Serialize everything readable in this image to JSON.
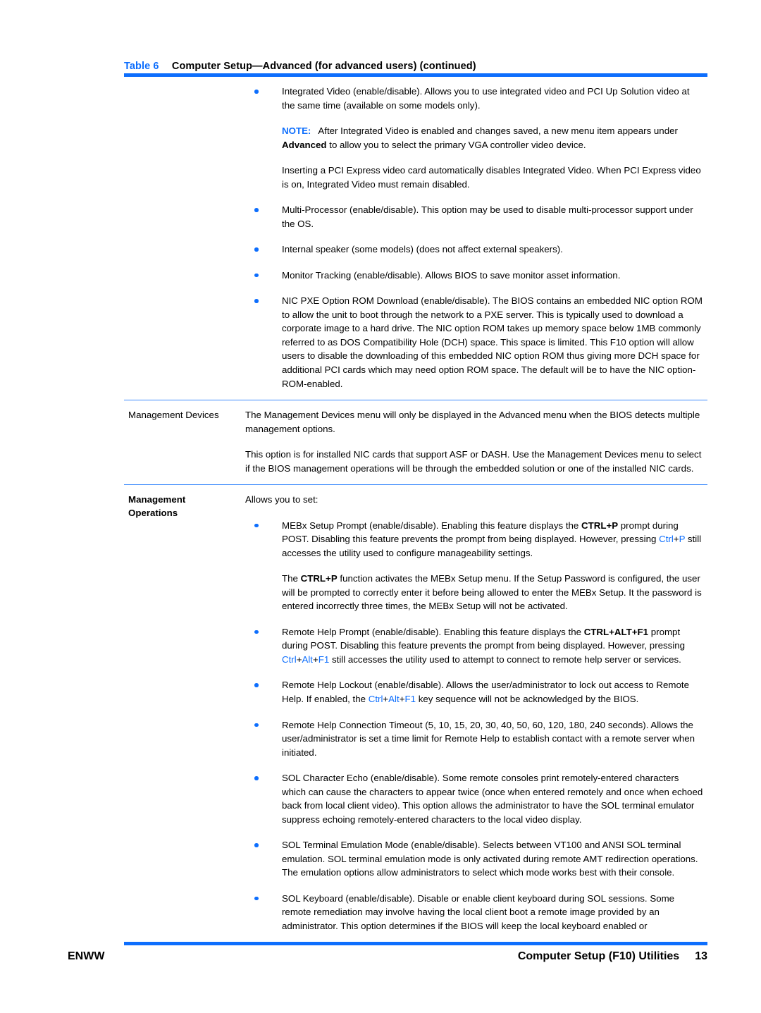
{
  "caption": {
    "label": "Table 6",
    "title": "Computer Setup—Advanced (for advanced users) (continued)"
  },
  "colors": {
    "accent_blue": "#0d6efd",
    "rule_blue": "#3d8bfd",
    "text": "#000000"
  },
  "rows": [
    {
      "label": "",
      "blocks": [
        {
          "kind": "bullet",
          "text": "Integrated Video (enable/disable). Allows you to use integrated video and PCI Up Solution video at the same time (available on some models only)."
        },
        {
          "kind": "note",
          "note_label": "NOTE:",
          "pre": "After Integrated Video is enabled and changes saved, a new menu item appears under ",
          "bold": "Advanced",
          "post": " to allow you to select the primary VGA controller video device."
        },
        {
          "kind": "indent",
          "text": "Inserting a PCI Express video card automatically disables Integrated Video. When PCI Express video is on, Integrated Video must remain disabled."
        },
        {
          "kind": "bullet",
          "text": "Multi-Processor (enable/disable). This option may be used to disable multi-processor support under the OS."
        },
        {
          "kind": "bullet",
          "text": "Internal speaker (some models) (does not affect external speakers)."
        },
        {
          "kind": "bullet",
          "text": "Monitor Tracking (enable/disable). Allows BIOS to save monitor asset information."
        },
        {
          "kind": "bullet",
          "text": "NIC PXE Option ROM Download (enable/disable). The BIOS contains an embedded NIC option ROM to allow the unit to boot through the network to a PXE server. This is typically used to download a corporate image to a hard drive. The NIC option ROM takes up memory space below 1MB commonly referred to as DOS Compatibility Hole (DCH) space. This space is limited. This F10 option will allow users to disable the downloading of this embedded NIC option ROM thus giving more DCH space for additional PCI cards which may need option ROM space. The default will be to have the NIC option-ROM-enabled."
        }
      ]
    },
    {
      "label": "Management Devices",
      "label_bold": false,
      "blocks": [
        {
          "kind": "para",
          "text": "The Management Devices menu will only be displayed in the Advanced menu when the BIOS detects multiple management options."
        },
        {
          "kind": "para",
          "text": "This option is for installed NIC cards that support ASF or DASH. Use the Management Devices menu to select if the BIOS management operations will be through the embedded solution or one of the installed NIC cards."
        }
      ]
    },
    {
      "label": "Management Operations",
      "label_line1": "Management",
      "label_line2": "Operations",
      "label_bold": true,
      "blocks": [
        {
          "kind": "para",
          "text": "Allows you to set:"
        },
        {
          "kind": "bullet-mebx",
          "p1": "MEBx Setup Prompt (enable/disable). Enabling this feature displays the ",
          "kb1": "CTRL+P",
          "p2": " prompt during POST. Disabling this feature prevents the prompt from being displayed. However, pressing ",
          "k_ctrl": "Ctrl",
          "k_plus": "+",
          "k_p": "P",
          "p3": " still accesses the utility used to configure manageability settings."
        },
        {
          "kind": "indent-ctrlp",
          "p1": "The ",
          "kb1": "CTRL+P",
          "p2": " function activates the MEBx Setup menu. If the Setup Password is configured, the user will be prompted to correctly enter it before being allowed to enter the MEBx Setup. It the password is entered incorrectly three times, the MEBx Setup will not be activated."
        },
        {
          "kind": "bullet-remotehelp",
          "p1": "Remote Help Prompt (enable/disable). Enabling this feature displays the ",
          "kb1": "CTRL+ALT+F1",
          "p2": " prompt during POST. Disabling this feature prevents the prompt from being displayed. However, pressing ",
          "k_ctrl": "Ctrl",
          "k_alt": "Alt",
          "k_f1": "F1",
          "p3": " still accesses the utility used to attempt to connect to remote help server or services."
        },
        {
          "kind": "bullet-lockout",
          "p1": "Remote Help Lockout (enable/disable). Allows the user/administrator to lock out access to Remote Help. If enabled, the ",
          "k_ctrl": "Ctrl",
          "k_alt": "Alt",
          "k_f1": "F1",
          "p2": " key sequence will not be acknowledged by the BIOS."
        },
        {
          "kind": "bullet",
          "text": "Remote Help Connection Timeout (5, 10, 15, 20, 30, 40, 50, 60, 120, 180, 240 seconds). Allows the user/administrator is set a time limit for Remote Help to establish contact with a remote server when initiated."
        },
        {
          "kind": "bullet",
          "text": "SOL Character Echo (enable/disable). Some remote consoles print remotely-entered characters which can cause the characters to appear twice (once when entered remotely and once when echoed back from local client video). This option allows the administrator to have the SOL terminal emulator suppress echoing remotely-entered characters to the local video display."
        },
        {
          "kind": "bullet",
          "text": "SOL Terminal Emulation Mode (enable/disable). Selects between VT100 and ANSI SOL terminal emulation. SOL terminal emulation mode is only activated during remote AMT redirection operations. The emulation options allow administrators to select which mode works best with their console."
        },
        {
          "kind": "bullet",
          "text": "SOL Keyboard (enable/disable). Disable or enable client keyboard during SOL sessions. Some remote remediation may involve having the local client boot a remote image provided by an administrator. This option determines if the BIOS will keep the local keyboard enabled or"
        }
      ]
    }
  ],
  "footer": {
    "left": "ENWW",
    "right_title": "Computer Setup (F10) Utilities",
    "page_number": "13"
  }
}
